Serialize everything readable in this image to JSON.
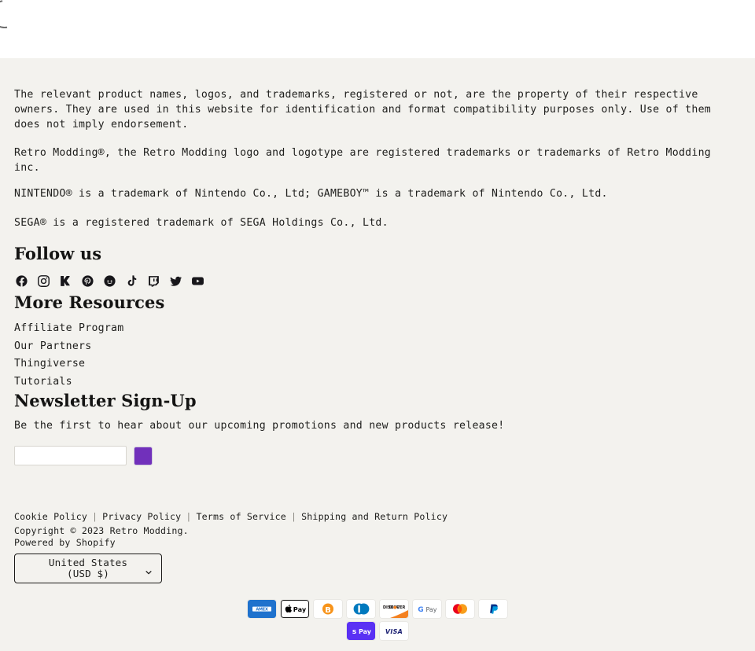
{
  "loading": {
    "spinner_label": "loading-spinner"
  },
  "legal": {
    "paragraphs": [
      "The relevant product names, logos, and trademarks, registered or not, are the property of their respective owners. They are used in this website for identification and format compatibility purposes only. Use of them does not imply endorsement.",
      "Retro Modding®, the Retro Modding logo and logotype are registered trademarks or trademarks of Retro Modding inc.",
      "NINTENDO® is a trademark of Nintendo Co., Ltd; GAMEBOY™ is a trademark of Nintendo Co., Ltd.",
      "SEGA® is a registered trademark of SEGA Holdings Co., Ltd."
    ]
  },
  "follow": {
    "heading": "Follow us",
    "links": [
      {
        "name": "facebook",
        "label": "Facebook"
      },
      {
        "name": "instagram",
        "label": "Instagram"
      },
      {
        "name": "kickstarter",
        "label": "Kickstarter"
      },
      {
        "name": "pinterest",
        "label": "Pinterest"
      },
      {
        "name": "reddit",
        "label": "Reddit"
      },
      {
        "name": "tiktok",
        "label": "TikTok"
      },
      {
        "name": "twitch",
        "label": "Twitch"
      },
      {
        "name": "twitter",
        "label": "Twitter"
      },
      {
        "name": "youtube",
        "label": "YouTube"
      }
    ]
  },
  "resources": {
    "heading": "More Resources",
    "items": [
      {
        "label": "Affiliate Program"
      },
      {
        "label": "Our Partners"
      },
      {
        "label": "Thingiverse"
      },
      {
        "label": "Tutorials"
      }
    ]
  },
  "newsletter": {
    "heading": "Newsletter Sign-Up",
    "subtitle": "Be the first to hear about our upcoming promotions and new products release!",
    "input_value": "",
    "input_placeholder": "",
    "submit_label": "",
    "submit_color": "#7130bb"
  },
  "bottom": {
    "policies": [
      {
        "label": "Cookie Policy"
      },
      {
        "label": "Privacy Policy"
      },
      {
        "label": "Terms of Service"
      },
      {
        "label": "Shipping and Return Policy"
      }
    ],
    "separator": "|",
    "copyright": "Copyright © 2023 Retro Modding.",
    "powered_prefix": "Powered by ",
    "powered_link": "Shopify",
    "country": {
      "line1": "United States",
      "line2": "(USD $)"
    }
  },
  "payments": {
    "row1": [
      {
        "name": "amex",
        "label": "American Express"
      },
      {
        "name": "apple-pay",
        "label": "Apple Pay"
      },
      {
        "name": "bitcoin",
        "label": "Bitcoin"
      },
      {
        "name": "diners-club",
        "label": "Diners Club"
      },
      {
        "name": "discover",
        "label": "Discover"
      },
      {
        "name": "google-pay",
        "label": "Google Pay"
      },
      {
        "name": "mastercard",
        "label": "Mastercard"
      },
      {
        "name": "paypal",
        "label": "PayPal"
      }
    ],
    "row2": [
      {
        "name": "shop-pay",
        "label": "Shop Pay"
      },
      {
        "name": "visa",
        "label": "Visa"
      }
    ]
  },
  "colors": {
    "footer_bg": "#f3f2ee",
    "text": "#20201e",
    "accent_purple": "#7130bb"
  }
}
